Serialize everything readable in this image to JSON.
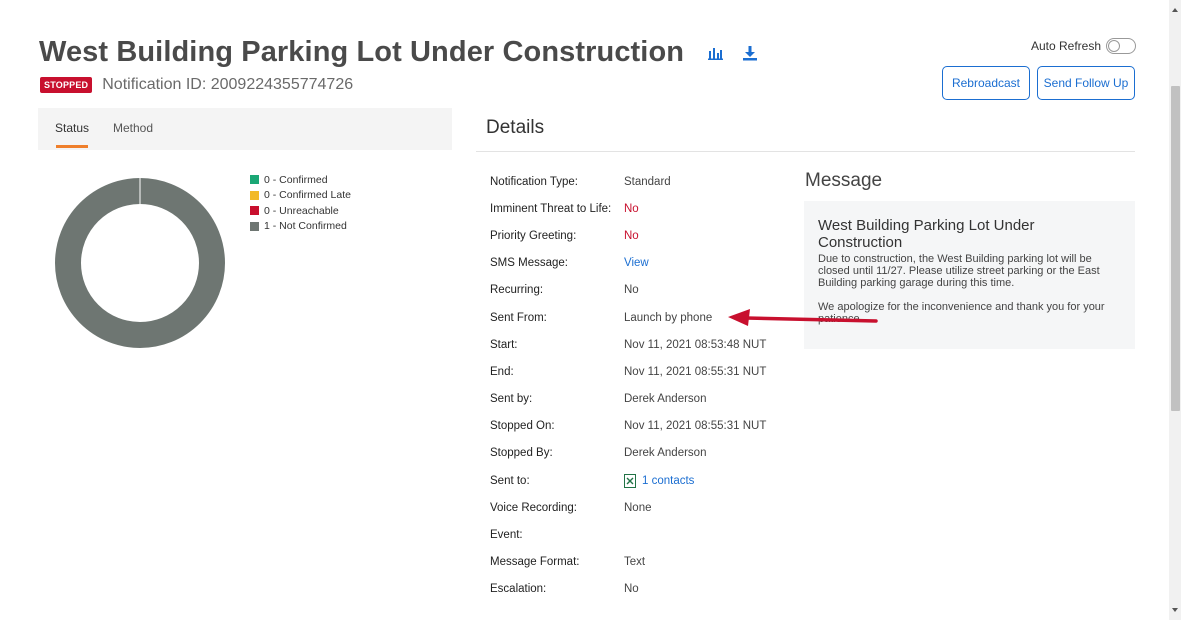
{
  "header": {
    "title": "West Building Parking Lot Under Construction",
    "status_badge": "STOPPED",
    "notification_id": "Notification ID: 2009224355774726",
    "icons": [
      "bar-chart-icon",
      "download-icon"
    ]
  },
  "toolbar": {
    "auto_refresh_label": "Auto Refresh",
    "auto_refresh_on": false,
    "rebroadcast_label": "Rebroadcast",
    "send_follow_up_label": "Send Follow Up"
  },
  "status_panel": {
    "tabs": [
      {
        "label": "Status",
        "active": true
      },
      {
        "label": "Method",
        "active": false
      }
    ],
    "legend": [
      {
        "label": "0 - Confirmed",
        "color": "#1aa775"
      },
      {
        "label": "0 - Confirmed Late",
        "color": "#f2b927"
      },
      {
        "label": "0 - Unreachable",
        "color": "#c8102e"
      },
      {
        "label": "1 - Not Confirmed",
        "color": "#6e7672"
      }
    ]
  },
  "chart_data": {
    "type": "pie",
    "donut": true,
    "categories": [
      "Confirmed",
      "Confirmed Late",
      "Unreachable",
      "Not Confirmed"
    ],
    "values": [
      0,
      0,
      0,
      1
    ],
    "colors": [
      "#1aa775",
      "#f2b927",
      "#c8102e",
      "#6e7672"
    ],
    "legend_position": "right"
  },
  "details": {
    "title": "Details",
    "rows": [
      {
        "label": "Notification Type:",
        "value": "Standard",
        "style": ""
      },
      {
        "label": "Imminent Threat to Life:",
        "value": "No",
        "style": "red"
      },
      {
        "label": "Priority Greeting:",
        "value": "No",
        "style": "red"
      },
      {
        "label": "SMS Message:",
        "value": "View",
        "style": "link"
      },
      {
        "label": "Recurring:",
        "value": "No",
        "style": ""
      },
      {
        "label": "Sent From:",
        "value": "Launch by phone",
        "style": ""
      },
      {
        "label": "Start:",
        "value": "Nov 11, 2021 08:53:48 NUT",
        "style": ""
      },
      {
        "label": "End:",
        "value": "Nov 11, 2021 08:55:31 NUT",
        "style": ""
      },
      {
        "label": "Sent by:",
        "value": "Derek Anderson",
        "style": ""
      },
      {
        "label": "Stopped On:",
        "value": "Nov 11, 2021 08:55:31 NUT",
        "style": ""
      },
      {
        "label": "Stopped By:",
        "value": "Derek Anderson",
        "style": ""
      },
      {
        "label": "Sent to:",
        "value": "1  contacts",
        "style": "link"
      },
      {
        "label": "Voice Recording:",
        "value": "None",
        "style": ""
      },
      {
        "label": "Event:",
        "value": "",
        "style": ""
      },
      {
        "label": "Message Format:",
        "value": "Text",
        "style": ""
      },
      {
        "label": "Escalation:",
        "value": "No",
        "style": ""
      }
    ]
  },
  "message": {
    "section_title": "Message",
    "heading": "West Building Parking Lot Under Construction",
    "body": "Due to construction, the West Building parking lot will be closed until 11/27. Please utilize street parking or the East Building parking garage during this time.",
    "body2": "We apologize for the inconvenience and thank you for your patience."
  }
}
